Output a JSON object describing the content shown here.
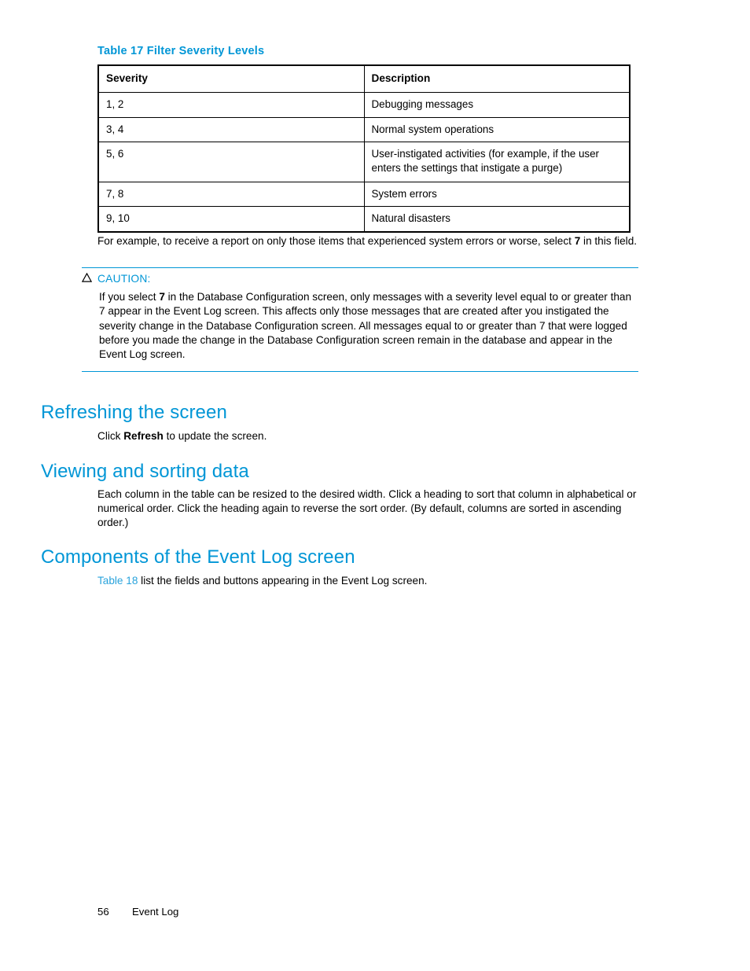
{
  "page": {
    "footer_page_number": "56",
    "footer_section_title": "Event Log"
  },
  "table17": {
    "caption": "Table 17 Filter Severity Levels",
    "columns": [
      "Severity",
      "Description"
    ],
    "rows": [
      {
        "severity": "1, 2",
        "description_line1": "Debugging messages",
        "description_line2": ""
      },
      {
        "severity": "3, 4",
        "description_line1": "Normal system operations",
        "description_line2": ""
      },
      {
        "severity": "5, 6",
        "description_line1": "User-instigated activities (for example, if the user",
        "description_line2": "enters the settings that instigate a purge)"
      },
      {
        "severity": "7, 8",
        "description_line1": "System errors",
        "description_line2": ""
      },
      {
        "severity": "9, 10",
        "description_line1": "Natural disasters",
        "description_line2": ""
      }
    ]
  },
  "example_paragraph": {
    "part1": "For example, to receive a report on only those items that experienced system errors or worse, select ",
    "bold": "7",
    "part2": " in this field."
  },
  "caution": {
    "icon": "warning-triangle-icon",
    "label": "CAUTION:",
    "body_part1": "If you select ",
    "body_bold": "7",
    "body_part2": " in the Database Configuration screen, only messages with a severity level equal to or greater than 7 appear in the Event Log screen. This affects only those messages that are created after you instigated the severity change in the Database Configuration screen. All messages equal to or greater than 7 that were logged before you made the change in the Database Configuration screen remain in the database and appear in the Event Log screen."
  },
  "sections": {
    "refreshing": {
      "heading": "Refreshing the screen",
      "body_part1": "Click ",
      "body_bold": "Refresh",
      "body_part2": " to update the screen."
    },
    "viewing": {
      "heading": "Viewing and sorting data",
      "body": "Each column in the table can be resized to the desired width.  Click a heading to sort that column in alphabetical or numerical order.  Click the heading again to reverse the sort order.  (By default, columns are sorted in ascending order.)"
    },
    "components": {
      "heading": "Components of the Event Log screen",
      "xref": "Table 18",
      "body_rest": " list the fields and buttons appearing in the Event Log screen."
    }
  },
  "colors": {
    "accent_blue": "#0096D6",
    "xref_blue": "#29A3DC",
    "text_black": "#000000"
  }
}
